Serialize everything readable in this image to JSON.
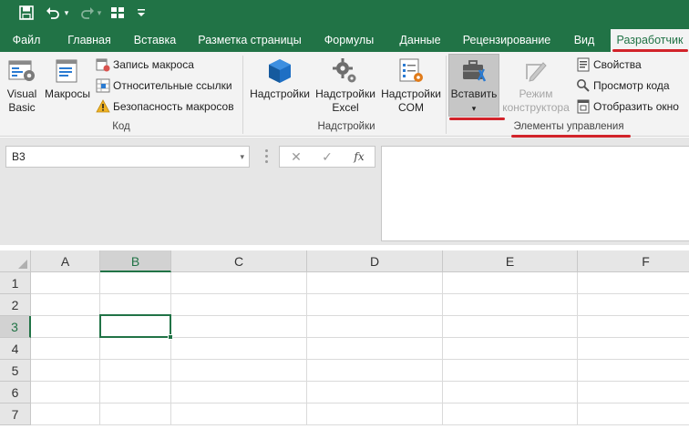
{
  "quick_access": {
    "save_icon": "save-icon",
    "undo_icon": "undo-icon",
    "redo_icon": "redo-icon",
    "form_icon": "form-icon",
    "customize_icon": "customize-qat-icon"
  },
  "tabs": [
    {
      "label": "Файл"
    },
    {
      "label": "Главная"
    },
    {
      "label": "Вставка"
    },
    {
      "label": "Разметка страницы"
    },
    {
      "label": "Формулы"
    },
    {
      "label": "Данные"
    },
    {
      "label": "Рецензирование"
    },
    {
      "label": "Вид"
    },
    {
      "label": "Разработчик",
      "active": true
    }
  ],
  "ribbon": {
    "code_group": {
      "label": "Код",
      "visual_basic_line1": "Visual",
      "visual_basic_line2": "Basic",
      "macros": "Макросы",
      "record_macro": "Запись макроса",
      "relative_refs": "Относительные ссылки",
      "macro_security": "Безопасность макросов"
    },
    "addins_group": {
      "label": "Надстройки",
      "addins": "Надстройки",
      "excel_addins_line1": "Надстройки",
      "excel_addins_line2": "Excel",
      "com_addins_line1": "Надстройки",
      "com_addins_line2": "COM"
    },
    "controls_group": {
      "label": "Элементы управления",
      "insert": "Вставить",
      "insert_arrow": "▾",
      "design_mode_line1": "Режим",
      "design_mode_line2": "конструктора",
      "properties": "Свойства",
      "view_code": "Просмотр кода",
      "run_dialog": "Отобразить окно"
    }
  },
  "formula_bar": {
    "name_box": "B3",
    "name_box_arrow": "▾",
    "cancel_symbol": "✕",
    "enter_symbol": "✓",
    "fx_symbol": "fx",
    "formula_value": ""
  },
  "grid": {
    "columns": [
      "A",
      "B",
      "C",
      "D",
      "E",
      "F"
    ],
    "rows": [
      "1",
      "2",
      "3",
      "4",
      "5",
      "6",
      "7"
    ],
    "selected_cell": "B3"
  },
  "colors": {
    "accent": "#217346",
    "annotation": "#d2232a"
  }
}
